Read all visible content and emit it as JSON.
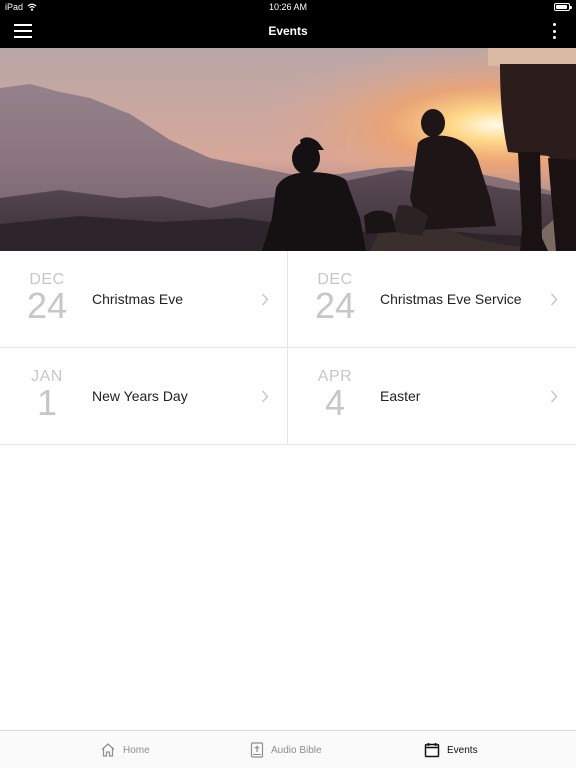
{
  "status_bar": {
    "device": "iPad",
    "time": "10:26 AM"
  },
  "nav": {
    "title": "Events",
    "menu_icon": "hamburger-menu-icon",
    "more_icon": "vertical-ellipsis-icon"
  },
  "hero": {
    "image": "sunset-mountains-people-photo"
  },
  "events": [
    {
      "month": "DEC",
      "day": "24",
      "title": "Christmas Eve"
    },
    {
      "month": "DEC",
      "day": "24",
      "title": "Christmas Eve Service"
    },
    {
      "month": "JAN",
      "day": "1",
      "title": "New Years Day"
    },
    {
      "month": "APR",
      "day": "4",
      "title": "Easter"
    }
  ],
  "tabs": [
    {
      "label": "Home",
      "icon": "home-icon",
      "active": false
    },
    {
      "label": "Audio Bible",
      "icon": "bible-icon",
      "active": false
    },
    {
      "label": "Events",
      "icon": "calendar-icon",
      "active": true
    }
  ],
  "colors": {
    "bar_background": "#000000",
    "date_text": "#c7c7c7",
    "active_tab": "#111111",
    "inactive_tab": "#8e8e93"
  }
}
